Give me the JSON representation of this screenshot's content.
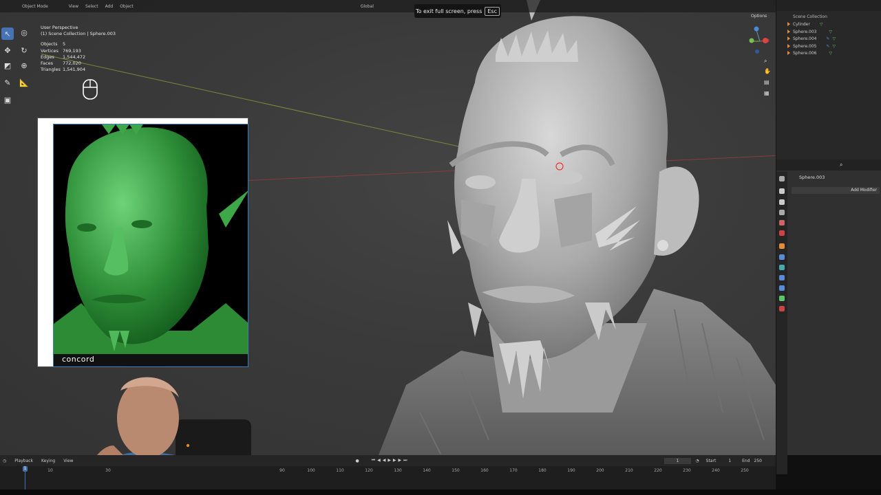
{
  "viewport": {
    "overlay": {
      "title": "User Perspective",
      "subtitle": "(1) Scene Collection | Sphere.003",
      "stats": [
        {
          "label": "Objects",
          "value": "5"
        },
        {
          "label": "Vertices",
          "value": "769,193"
        },
        {
          "label": "Edges",
          "value": "1,544,472"
        },
        {
          "label": "Faces",
          "value": "772,020"
        },
        {
          "label": "Triangles",
          "value": "1,541,904"
        }
      ]
    },
    "header": {
      "mode": "Object Mode",
      "menus": [
        "View",
        "Select",
        "Add",
        "Object"
      ],
      "orientation": "Global",
      "options": "Options"
    },
    "fullscreen_notice": {
      "text": "To exit full screen, press",
      "key": "Esc"
    },
    "reference_caption": "concord"
  },
  "outliner": {
    "title": "Scene Collection",
    "items": [
      {
        "label": "Cylinder"
      },
      {
        "label": "Sphere.003"
      },
      {
        "label": "Sphere.004"
      },
      {
        "label": "Sphere.005"
      },
      {
        "label": "Sphere.006"
      }
    ]
  },
  "properties": {
    "object_name": "Sphere.003",
    "add_modifier": "Add Modifier"
  },
  "timeline": {
    "menus": [
      "Playback",
      "Keying",
      "View"
    ],
    "current_frame": "1",
    "start_label": "Start",
    "start": "1",
    "end_label": "End",
    "end": "250",
    "ticks": [
      "10",
      "30",
      "90",
      "100",
      "110",
      "120",
      "130",
      "140",
      "150",
      "160",
      "170",
      "180",
      "190",
      "200",
      "210",
      "220",
      "230",
      "240",
      "250"
    ],
    "playhead": "1"
  },
  "colors": {
    "accent": "#4772b3",
    "object_orange": "#e38b3b",
    "mesh_green": "#5cc46b"
  }
}
